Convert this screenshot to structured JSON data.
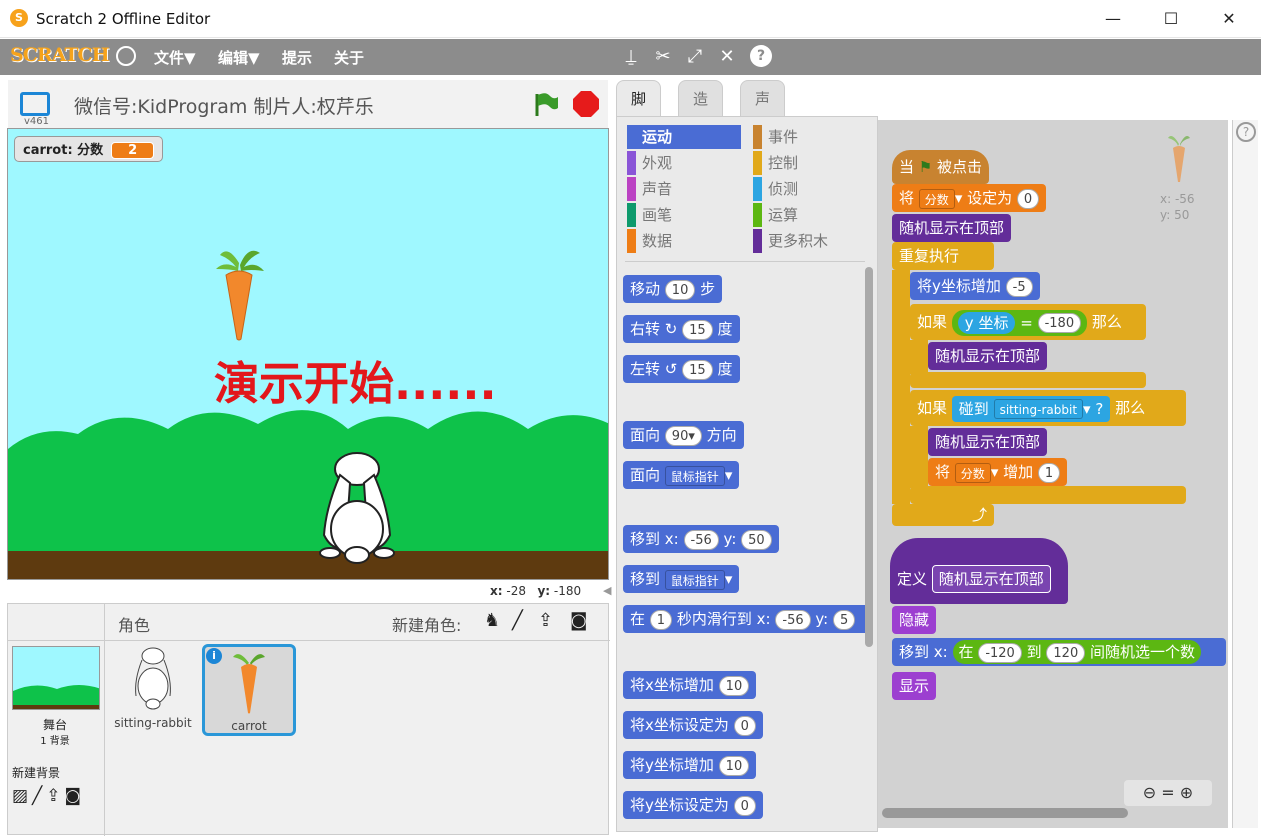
{
  "window": {
    "title": "Scratch 2 Offline Editor",
    "minimize": "—",
    "maximize": "☐",
    "close": "✕"
  },
  "menubar": {
    "logo": "SCRATCH",
    "items": [
      "文件▼",
      "编辑▼",
      "提示",
      "关于"
    ],
    "tools": [
      "duplicate-icon",
      "delete-icon",
      "grow-icon",
      "shrink-icon",
      "help-icon"
    ]
  },
  "stage": {
    "version": "v461",
    "project_title": "微信号:KidProgram 制片人:权芹乐",
    "monitor_label": "carrot: 分数",
    "monitor_value": "2",
    "overlay_text": "演示开始......",
    "coords": {
      "x_label": "x:",
      "x_value": "-28",
      "y_label": "y:",
      "y_value": "-180"
    }
  },
  "sprites": {
    "header": "角色",
    "new_sprite_label": "新建角色:",
    "stage_label": "舞台",
    "stage_backdrops": "1 背景",
    "new_backdrop_label": "新建背景",
    "items": [
      {
        "name": "sitting-rabbit"
      },
      {
        "name": "carrot"
      }
    ]
  },
  "tabs": [
    {
      "label": "脚本"
    },
    {
      "label": "造型"
    },
    {
      "label": "声音"
    }
  ],
  "categories": {
    "left": [
      {
        "label": "运动",
        "color": "#4a6cd4"
      },
      {
        "label": "外观",
        "color": "#8a55d7"
      },
      {
        "label": "声音",
        "color": "#bb42c3"
      },
      {
        "label": "画笔",
        "color": "#0e9a6c"
      },
      {
        "label": "数据",
        "color": "#ee7d16"
      }
    ],
    "right": [
      {
        "label": "事件",
        "color": "#c88330"
      },
      {
        "label": "控制",
        "color": "#e1a91a"
      },
      {
        "label": "侦测",
        "color": "#2ca5e2"
      },
      {
        "label": "运算",
        "color": "#5cb712"
      },
      {
        "label": "更多积木",
        "color": "#632d99"
      }
    ]
  },
  "palette": {
    "move": {
      "a": "移动",
      "v": "10",
      "b": "步"
    },
    "turn_right": {
      "a": "右转",
      "v": "15",
      "b": "度"
    },
    "turn_left": {
      "a": "左转",
      "v": "15",
      "b": "度"
    },
    "point_dir": {
      "a": "面向",
      "v": "90▾",
      "b": "方向"
    },
    "point_towards": {
      "a": "面向",
      "v": "鼠标指针"
    },
    "goto_xy": {
      "a": "移到",
      "x": "x:",
      "xv": "-56",
      "y": "y:",
      "yv": "50"
    },
    "goto": {
      "a": "移到",
      "v": "鼠标指针"
    },
    "glide": {
      "a": "在",
      "v": "1",
      "b": "秒内滑行到",
      "x": "x:",
      "xv": "-56",
      "y": "y:",
      "yv": "5"
    },
    "change_x": {
      "a": "将x坐标增加",
      "v": "10"
    },
    "set_x": {
      "a": "将x坐标设定为",
      "v": "0"
    },
    "change_y": {
      "a": "将y坐标增加",
      "v": "10"
    },
    "set_y": {
      "a": "将y坐标设定为",
      "v": "0"
    }
  },
  "script": {
    "sprite_x": "x: -56",
    "sprite_y": "y: 50",
    "hat_a": "当",
    "hat_b": "被点击",
    "set_a": "将",
    "set_var": "分数",
    "set_b": "设定为",
    "set_v": "0",
    "random_top": "随机显示在顶部",
    "forever": "重复执行",
    "change_y": "将y坐标增加",
    "change_y_v": "-5",
    "if1": "如果",
    "ypos": "y 坐标",
    "eq": "=",
    "eq_v": "-180",
    "then": "那么",
    "if1_body": "随机显示在顶部",
    "if2": "如果",
    "touch": "碰到",
    "touch_v": "sitting-rabbit",
    "touch_q": "?",
    "then2": "那么",
    "if2_body": "随机显示在顶部",
    "chg_a": "将",
    "chg_var": "分数",
    "chg_b": "增加",
    "chg_v": "1",
    "define": "定义",
    "define_name": "随机显示在顶部",
    "hide": "隐藏",
    "goto_a": "移到",
    "goto_x": "x:",
    "goto_in": "在",
    "goto_from": "-120",
    "goto_to_lbl": "到",
    "goto_to": "120",
    "goto_b": "间随机选一个数",
    "show": "显示"
  }
}
